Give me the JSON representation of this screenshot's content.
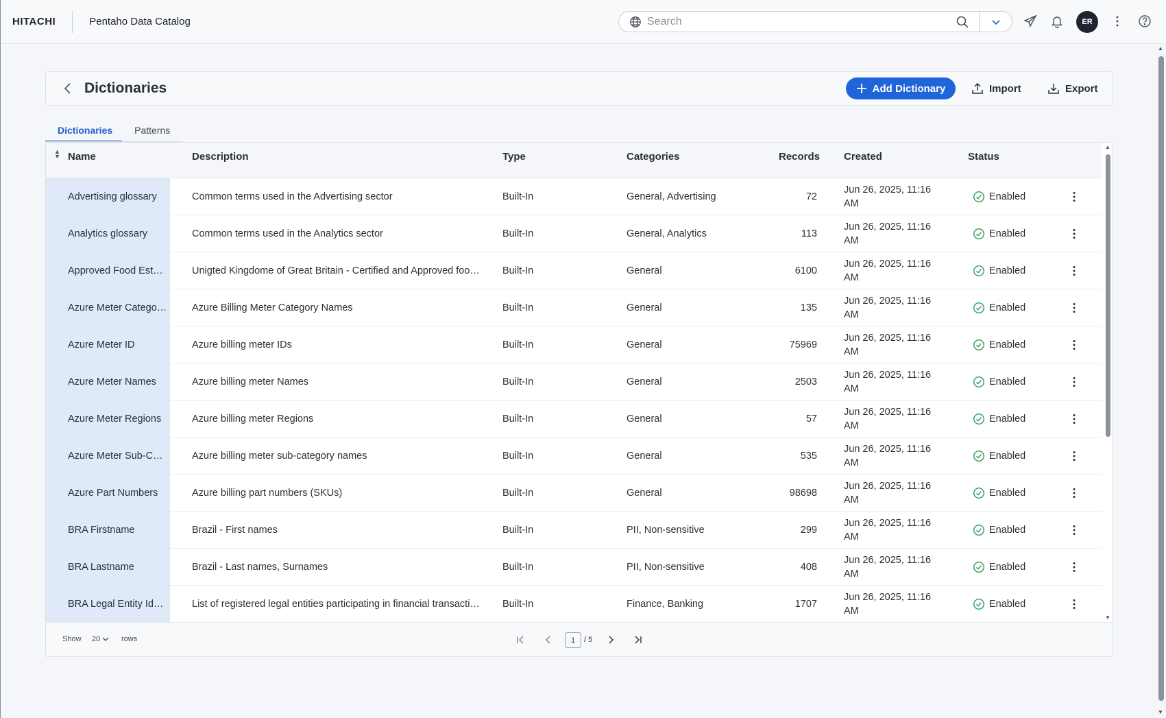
{
  "header": {
    "logo": "HITACHI",
    "app_name": "Pentaho Data Catalog",
    "search_placeholder": "Search",
    "avatar_initials": "ER"
  },
  "page": {
    "title": "Dictionaries",
    "add_label": "Add Dictionary",
    "import_label": "Import",
    "export_label": "Export"
  },
  "tabs": [
    {
      "label": "Dictionaries",
      "active": true
    },
    {
      "label": "Patterns",
      "active": false
    }
  ],
  "table": {
    "columns": {
      "name": "Name",
      "description": "Description",
      "type": "Type",
      "categories": "Categories",
      "records": "Records",
      "created": "Created",
      "status": "Status"
    },
    "rows": [
      {
        "name": "Advertising glossary",
        "description": "Common terms used in the Advertising sector",
        "type": "Built-In",
        "categories": "General, Advertising",
        "records": "72",
        "created": "Jun 26, 2025, 11:16 AM",
        "status": "Enabled"
      },
      {
        "name": "Analytics glossary",
        "description": "Common terms used in the Analytics sector",
        "type": "Built-In",
        "categories": "General, Analytics",
        "records": "113",
        "created": "Jun 26, 2025, 11:16 AM",
        "status": "Enabled"
      },
      {
        "name": "Approved Food Est…",
        "description": "Unigted Kingdome of Great Britain - Certified and Approved foo…",
        "type": "Built-In",
        "categories": "General",
        "records": "6100",
        "created": "Jun 26, 2025, 11:16 AM",
        "status": "Enabled"
      },
      {
        "name": "Azure Meter Catego…",
        "description": "Azure Billing Meter Category Names",
        "type": "Built-In",
        "categories": "General",
        "records": "135",
        "created": "Jun 26, 2025, 11:16 AM",
        "status": "Enabled"
      },
      {
        "name": "Azure Meter ID",
        "description": "Azure billing meter IDs",
        "type": "Built-In",
        "categories": "General",
        "records": "75969",
        "created": "Jun 26, 2025, 11:16 AM",
        "status": "Enabled"
      },
      {
        "name": "Azure Meter Names",
        "description": "Azure billing meter Names",
        "type": "Built-In",
        "categories": "General",
        "records": "2503",
        "created": "Jun 26, 2025, 11:16 AM",
        "status": "Enabled"
      },
      {
        "name": "Azure Meter Regions",
        "description": "Azure billing meter Regions",
        "type": "Built-In",
        "categories": "General",
        "records": "57",
        "created": "Jun 26, 2025, 11:16 AM",
        "status": "Enabled"
      },
      {
        "name": "Azure Meter Sub-C…",
        "description": "Azure billing meter sub-category names",
        "type": "Built-In",
        "categories": "General",
        "records": "535",
        "created": "Jun 26, 2025, 11:16 AM",
        "status": "Enabled"
      },
      {
        "name": "Azure Part Numbers",
        "description": "Azure billing part numbers (SKUs)",
        "type": "Built-In",
        "categories": "General",
        "records": "98698",
        "created": "Jun 26, 2025, 11:16 AM",
        "status": "Enabled"
      },
      {
        "name": "BRA Firstname",
        "description": "Brazil - First names",
        "type": "Built-In",
        "categories": "PII, Non-sensitive",
        "records": "299",
        "created": "Jun 26, 2025, 11:16 AM",
        "status": "Enabled"
      },
      {
        "name": "BRA Lastname",
        "description": "Brazil - Last names, Surnames",
        "type": "Built-In",
        "categories": "PII, Non-sensitive",
        "records": "408",
        "created": "Jun 26, 2025, 11:16 AM",
        "status": "Enabled"
      },
      {
        "name": "BRA Legal Entity Id…",
        "description": "List of registered legal entities participating in financial transacti…",
        "type": "Built-In",
        "categories": "Finance, Banking",
        "records": "1707",
        "created": "Jun 26, 2025, 11:16 AM",
        "status": "Enabled"
      }
    ]
  },
  "pagination": {
    "show_label": "Show",
    "page_size": "20",
    "rows_label": "rows",
    "current_page": "1",
    "total_pages": "/ 5"
  },
  "colors": {
    "accent": "#2064d9",
    "status_enabled": "#2e9c5b",
    "name_column_bg": "#dfe9f8"
  }
}
